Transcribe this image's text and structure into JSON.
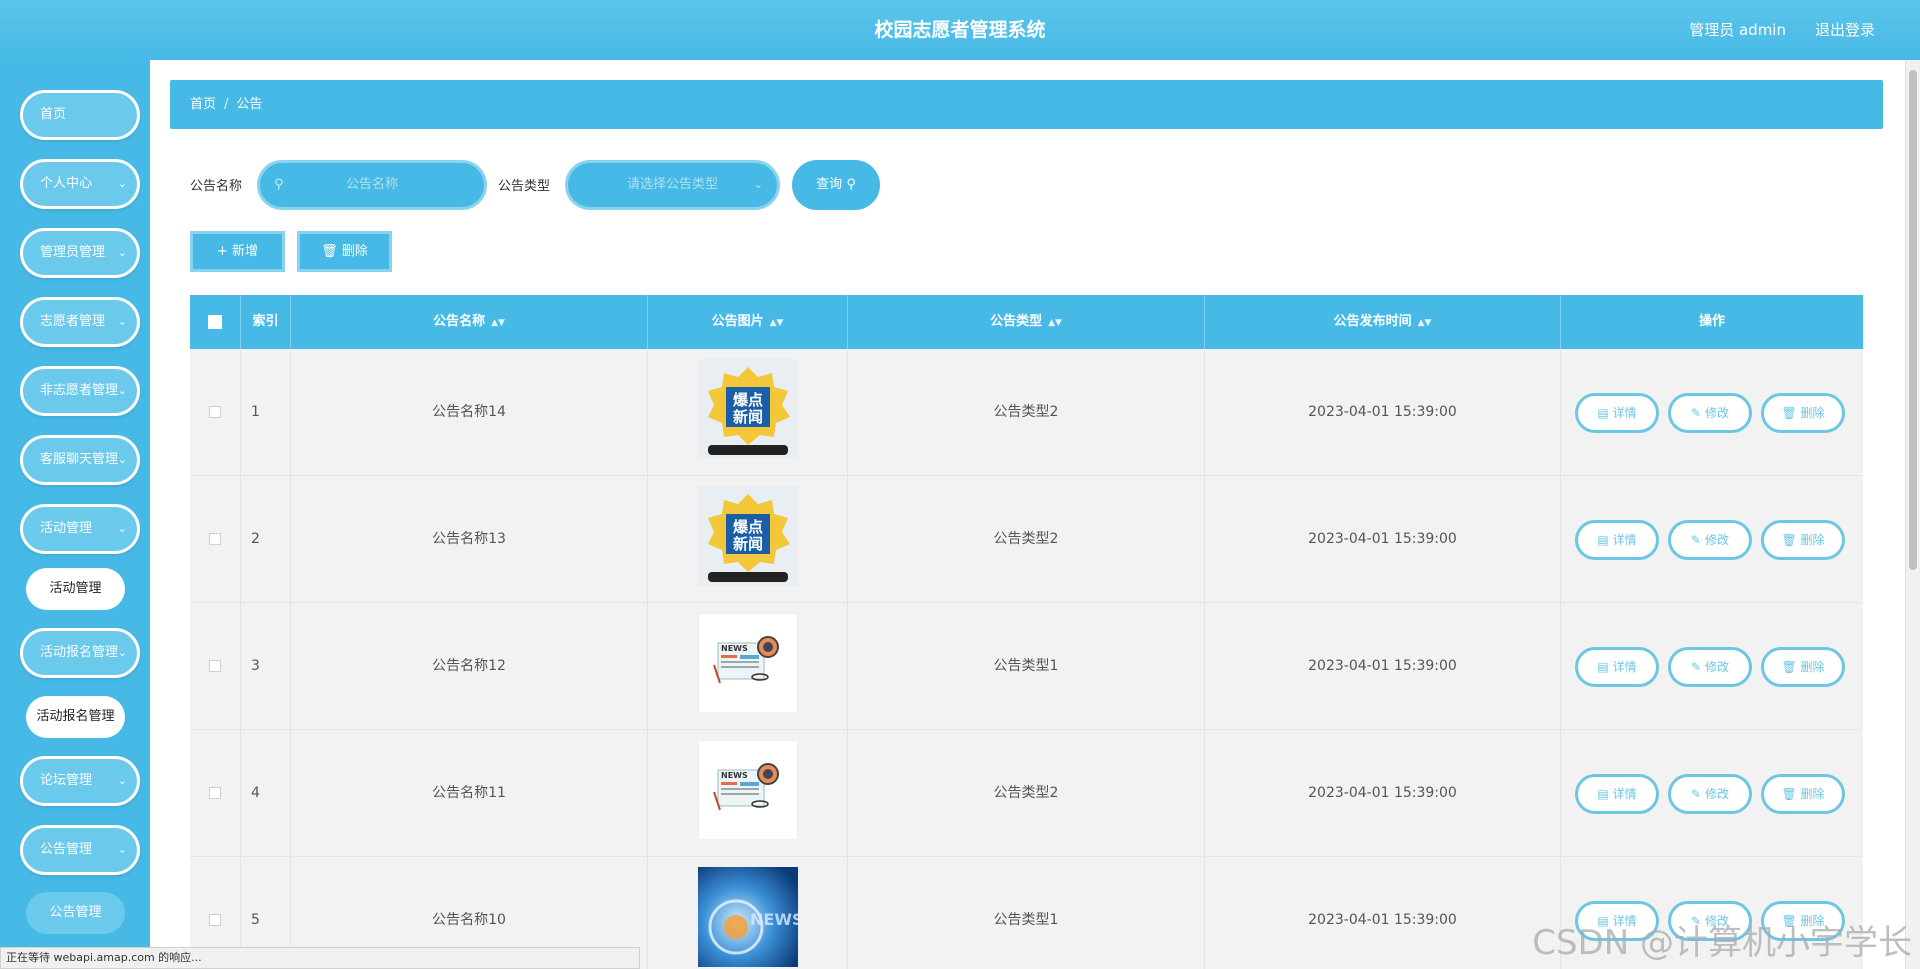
{
  "header": {
    "title": "校园志愿者管理系统",
    "user": "管理员 admin",
    "logout": "退出登录"
  },
  "sidebar": {
    "items": [
      {
        "label": "首页"
      },
      {
        "label": "个人中心"
      },
      {
        "label": "管理员管理"
      },
      {
        "label": "志愿者管理"
      },
      {
        "label": "非志愿者管理"
      },
      {
        "label": "客服聊天管理"
      },
      {
        "label": "活动管理"
      },
      {
        "label": "活动报名管理"
      },
      {
        "label": "论坛管理"
      },
      {
        "label": "公告管理"
      }
    ],
    "sub_items": [
      {
        "label": "活动管理"
      },
      {
        "label": "活动报名管理"
      },
      {
        "label": "公告管理"
      }
    ]
  },
  "breadcrumb": {
    "home": "首页",
    "current": "公告"
  },
  "search": {
    "name_label": "公告名称",
    "name_placeholder": "公告名称",
    "type_label": "公告类型",
    "type_placeholder": "请选择公告类型",
    "query": "查询"
  },
  "actions": {
    "add": "新增",
    "delete": "删除"
  },
  "table": {
    "columns": [
      "索引",
      "公告名称",
      "公告图片",
      "公告类型",
      "公告发布时间",
      "操作"
    ],
    "rows": [
      {
        "index": "1",
        "name": "公告名称14",
        "image": "breaking-news",
        "type": "公告类型2",
        "time": "2023-04-01 15:39:00"
      },
      {
        "index": "2",
        "name": "公告名称13",
        "image": "breaking-news",
        "type": "公告类型2",
        "time": "2023-04-01 15:39:00"
      },
      {
        "index": "3",
        "name": "公告名称12",
        "image": "newspaper",
        "type": "公告类型1",
        "time": "2023-04-01 15:39:00"
      },
      {
        "index": "4",
        "name": "公告名称11",
        "image": "newspaper",
        "type": "公告类型2",
        "time": "2023-04-01 15:39:00"
      },
      {
        "index": "5",
        "name": "公告名称10",
        "image": "news-globe",
        "type": "公告类型1",
        "time": "2023-04-01 15:39:00"
      }
    ],
    "ops": {
      "detail": "详情",
      "edit": "修改",
      "delete": "删除"
    }
  },
  "statusbar": "正在等待 webapi.amap.com 的响应...",
  "watermark": "CSDN @计算机小宇学长",
  "colors": {
    "primary": "#47b9e6",
    "menu": "#6bc9ec",
    "op_border": "#6cc6e4"
  }
}
